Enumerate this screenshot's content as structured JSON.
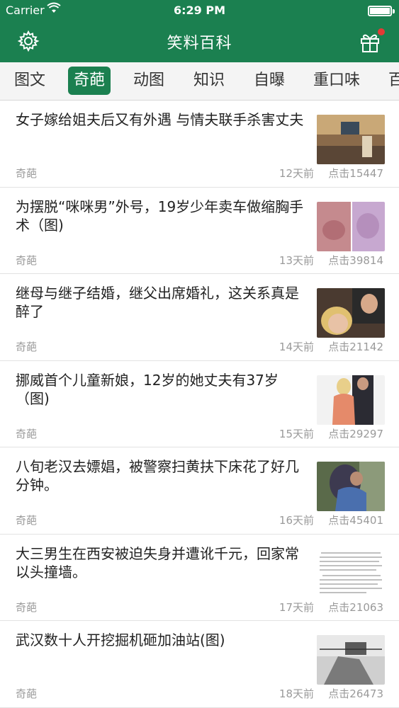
{
  "status_bar": {
    "carrier": "Carrier",
    "time": "6:29 PM"
  },
  "navbar": {
    "title": "笑料百科",
    "settings_icon": "gear-icon",
    "gift_icon": "gift-icon",
    "badge_color": "#e53935"
  },
  "colors": {
    "brand": "#1b8050",
    "meta_text": "#9a9a9a"
  },
  "tabs": [
    {
      "label": "图文",
      "active": false
    },
    {
      "label": "奇葩",
      "active": true
    },
    {
      "label": "动图",
      "active": false
    },
    {
      "label": "知识",
      "active": false
    },
    {
      "label": "自曝",
      "active": false
    },
    {
      "label": "重口味",
      "active": false
    },
    {
      "label": "百",
      "active": false
    }
  ],
  "articles": [
    {
      "title": "女子嫁给姐夫后又有外遇 与情夫联手杀害丈夫",
      "category": "奇葩",
      "date": "12天前",
      "clicks": "点击15447"
    },
    {
      "title": "为摆脱“咪咪男”外号，19岁少年卖车做缩胸手术（图)",
      "category": "奇葩",
      "date": "13天前",
      "clicks": "点击39814"
    },
    {
      "title": "继母与继子结婚，继父出席婚礼，这关系真是醉了",
      "category": "奇葩",
      "date": "14天前",
      "clicks": "点击21142"
    },
    {
      "title": "挪威首个儿童新娘，12岁的她丈夫有37岁（图)",
      "category": "奇葩",
      "date": "15天前",
      "clicks": "点击29297"
    },
    {
      "title": "八旬老汉去嫖娼，被警察扫黄扶下床花了好几分钟。",
      "category": "奇葩",
      "date": "16天前",
      "clicks": "点击45401"
    },
    {
      "title": "大三男生在西安被迫失身并遭讹千元，回家常以头撞墙。",
      "category": "奇葩",
      "date": "17天前",
      "clicks": "点击21063"
    },
    {
      "title": "武汉数十人开挖掘机砸加油站(图)",
      "category": "奇葩",
      "date": "18天前",
      "clicks": "点击26473"
    }
  ]
}
